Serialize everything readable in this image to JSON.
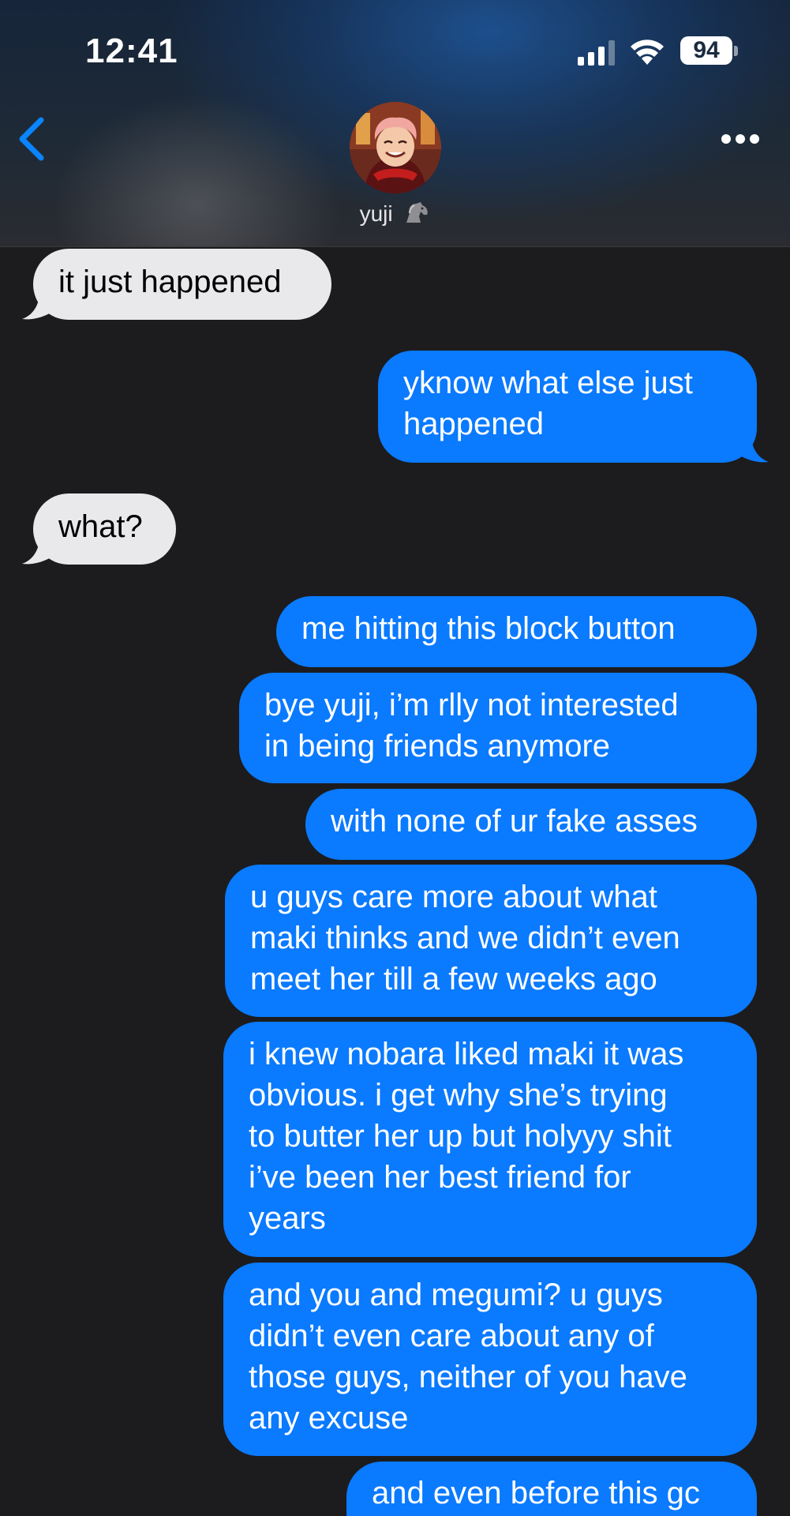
{
  "status_bar": {
    "time": "12:41",
    "battery": "94"
  },
  "contact": {
    "name": "yuji",
    "emoji_icon": "horse-icon"
  },
  "messages": [
    {
      "from": "them",
      "text": "it just happened"
    },
    {
      "from": "me",
      "lines": [
        "yknow what else just",
        "happened"
      ]
    },
    {
      "from": "them",
      "text": "what?"
    },
    {
      "from": "me",
      "lines": [
        "me hitting this block button"
      ]
    },
    {
      "from": "me",
      "lines": [
        "bye yuji, i’m rlly not interested",
        "in being friends anymore"
      ]
    },
    {
      "from": "me",
      "lines": [
        "with none of ur fake asses"
      ]
    },
    {
      "from": "me",
      "lines": [
        "u guys care more about what",
        "maki thinks and we didn’t even",
        "meet her till a few weeks ago"
      ]
    },
    {
      "from": "me",
      "lines": [
        "i knew nobara liked maki it was",
        "obvious. i get why she’s trying",
        "to butter her up but holyyy shit",
        "i’ve been her best friend for",
        "years"
      ]
    },
    {
      "from": "me",
      "lines": [
        "and you and megumi? u guys",
        "didn’t even care about any of",
        "those guys, neither of you have",
        "any excuse"
      ]
    },
    {
      "from": "me",
      "lines": [
        "and even before this gc"
      ]
    }
  ],
  "colors": {
    "incoming": "#e9e9eb",
    "outgoing": "#0a7aff",
    "background": "#1c1c1e",
    "accent": "#0a84ff"
  }
}
